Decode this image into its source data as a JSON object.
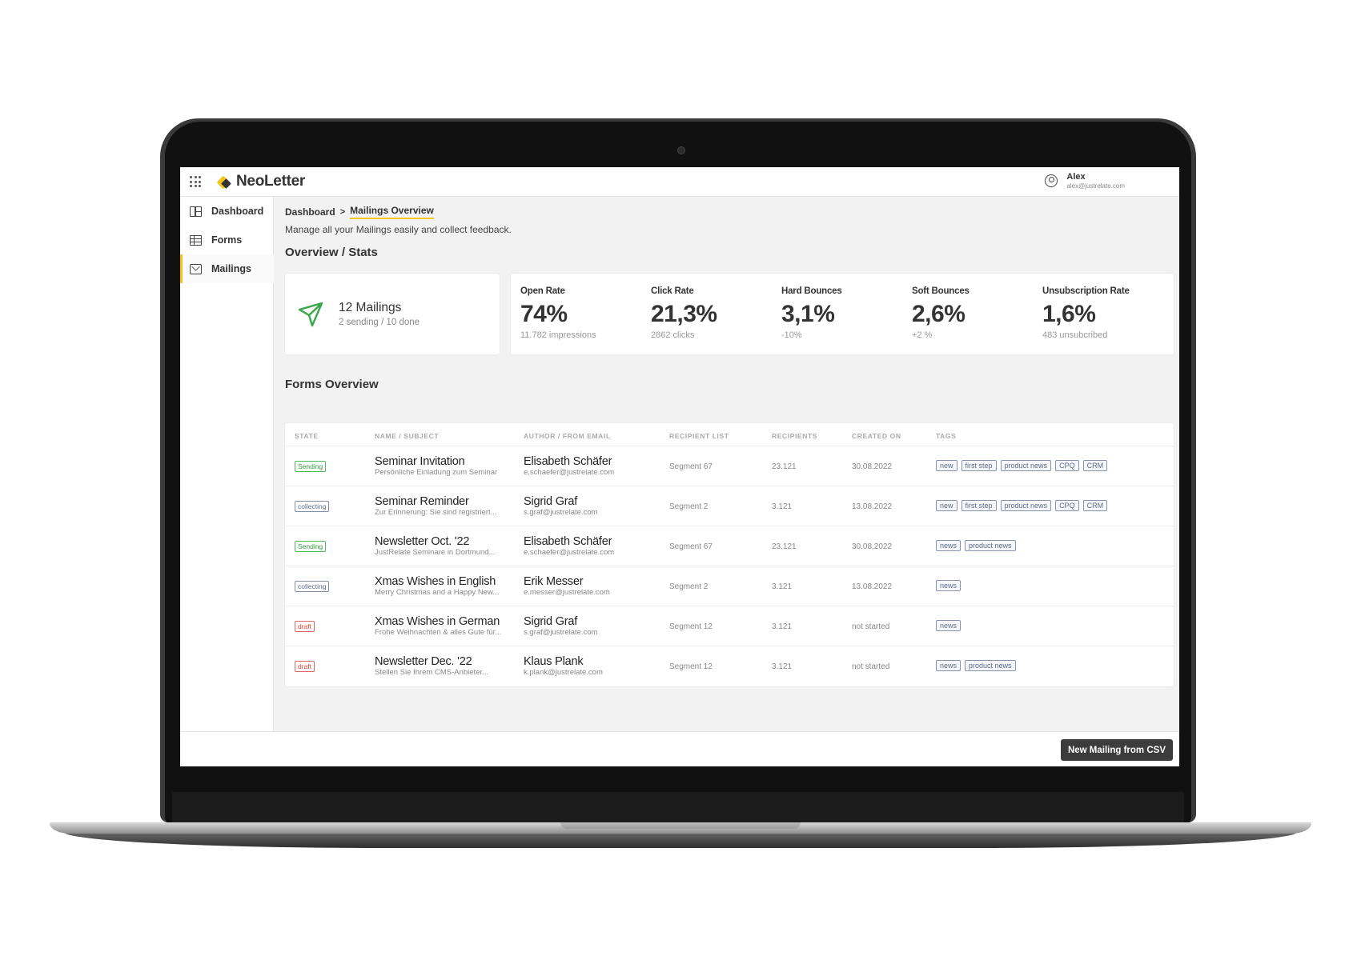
{
  "app": {
    "logo": "NeoLetter",
    "user_name": "Alex",
    "user_email": "alex@justrelate.com"
  },
  "sidebar": {
    "items": [
      {
        "label": "Dashboard",
        "icon": "dashboard-icon"
      },
      {
        "label": "Forms",
        "icon": "table-icon"
      },
      {
        "label": "Mailings",
        "icon": "mail-icon",
        "active": true
      }
    ]
  },
  "breadcrumb": {
    "root": "Dashboard",
    "current": "Mailings Overview"
  },
  "subtitle": "Manage all your Mailings easily and collect feedback.",
  "overview": {
    "title": "Overview / Stats",
    "mailings_count": "12 Mailings",
    "mailings_status": "2 sending / 10 done",
    "stats": [
      {
        "label": "Open Rate",
        "value": "74%",
        "sub": "11.782 impressions"
      },
      {
        "label": "Click Rate",
        "value": "21,3%",
        "sub": "2862 clicks"
      },
      {
        "label": "Hard Bounces",
        "value": "3,1%",
        "sub": "-10%"
      },
      {
        "label": "Soft Bounces",
        "value": "2,6%",
        "sub": "+2 %"
      },
      {
        "label": "Unsubscription Rate",
        "value": "1,6%",
        "sub": "483 unsubcribed"
      }
    ]
  },
  "forms_overview": {
    "title": "Forms Overview",
    "columns": [
      "STATE",
      "NAME / SUBJECT",
      "AUTHOR / FROM EMAIL",
      "RECIPIENT LIST",
      "RECIPIENTS",
      "CREATED ON",
      "TAGS"
    ],
    "rows": [
      {
        "state": "Sending",
        "state_type": "sending",
        "name": "Seminar Invitation",
        "subject": "Persönliche Einladung zum Seminar",
        "author": "Elisabeth Schäfer",
        "email": "e.schaefer@justrelate.com",
        "list": "Segment 67",
        "recipients": "23.121",
        "created": "30.08.2022",
        "tags": [
          "new",
          "first step",
          "product news",
          "CPQ",
          "CRM"
        ]
      },
      {
        "state": "collecting",
        "state_type": "collecting",
        "name": "Seminar Reminder",
        "subject": "Zur Erinnerung: Sie sind registriert...",
        "author": "Sigrid Graf",
        "email": "s.graf@justrelate.com",
        "list": "Segment 2",
        "recipients": "3.121",
        "created": "13.08.2022",
        "tags": [
          "new",
          "first step",
          "product news",
          "CPQ",
          "CRM"
        ]
      },
      {
        "state": "Sending",
        "state_type": "sending",
        "name": "Newsletter Oct. '22",
        "subject": "JustRelate Seminare in Dortmund...",
        "author": "Elisabeth Schäfer",
        "email": "e.schaefer@justrelate.com",
        "list": "Segment 67",
        "recipients": "23.121",
        "created": "30.08.2022",
        "tags": [
          "news",
          "product news"
        ]
      },
      {
        "state": "collecting",
        "state_type": "collecting",
        "name": "Xmas Wishes in English",
        "subject": "Merry Christmas and a Happy New...",
        "author": "Erik Messer",
        "email": "e.messer@justrelate.com",
        "list": "Segment 2",
        "recipients": "3.121",
        "created": "13.08.2022",
        "tags": [
          "news"
        ]
      },
      {
        "state": "draft",
        "state_type": "draft",
        "name": "Xmas Wishes in German",
        "subject": "Frohe Weihnachten & alles Gute für...",
        "author": "Sigrid Graf",
        "email": "s.graf@justrelate.com",
        "list": "Segment 12",
        "recipients": "3.121",
        "created": "not started",
        "tags": [
          "news"
        ]
      },
      {
        "state": "draft",
        "state_type": "draft",
        "name": "Newsletter Dec. '22",
        "subject": "Stellen Sie Ihrem CMS-Anbieter...",
        "author": "Klaus Plank",
        "email": "k.plank@justrelate.com",
        "list": "Segment 12",
        "recipients": "3.121",
        "created": "not started",
        "tags": [
          "news",
          "product news"
        ]
      }
    ]
  },
  "footer": {
    "csv_button": "New Mailing from CSV"
  },
  "colors": {
    "accent": "#f5c518",
    "sending": "#2e9e3e",
    "collecting": "#5a6b8a",
    "draft": "#d9443f",
    "send_icon": "#3aa64a"
  }
}
